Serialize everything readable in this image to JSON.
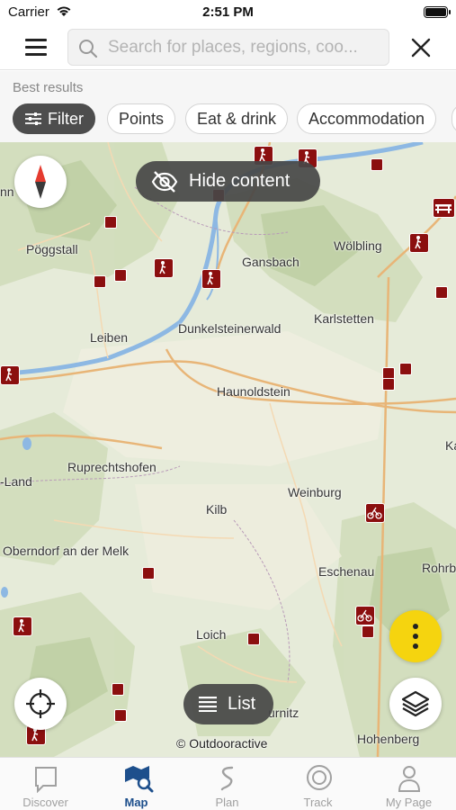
{
  "status_bar": {
    "carrier": "Carrier",
    "time": "2:51 PM"
  },
  "search": {
    "placeholder": "Search for places, regions, coo..."
  },
  "filters": {
    "section_label": "Best results",
    "chips": [
      "Filter",
      "Points",
      "Eat & drink",
      "Accommodation"
    ]
  },
  "map": {
    "hide_content_label": "Hide content",
    "list_label": "List",
    "attribution": "© Outdooractive",
    "places": [
      "nn",
      "Pöggstall",
      "Gansbach",
      "Wölbling",
      "Leiben",
      "Dunkelsteinerwald",
      "Karlstetten",
      "Haunoldstein",
      "Ka",
      "Ruprechtshofen",
      "-Land",
      "Weinburg",
      "Kilb",
      "Oberndorf an der Melk",
      "Eschenau",
      "Rohrba",
      "Loich",
      "urnitz",
      "Hohenberg"
    ],
    "colors": {
      "poi": "#8b0f0f",
      "more_button": "#f5d40f",
      "active_tab": "#1d4f8c"
    }
  },
  "tabs": [
    {
      "label": "Discover",
      "icon": "chat-bubble-icon"
    },
    {
      "label": "Map",
      "icon": "map-search-icon",
      "active": true
    },
    {
      "label": "Plan",
      "icon": "route-icon"
    },
    {
      "label": "Track",
      "icon": "record-icon"
    },
    {
      "label": "My Page",
      "icon": "person-icon"
    }
  ]
}
